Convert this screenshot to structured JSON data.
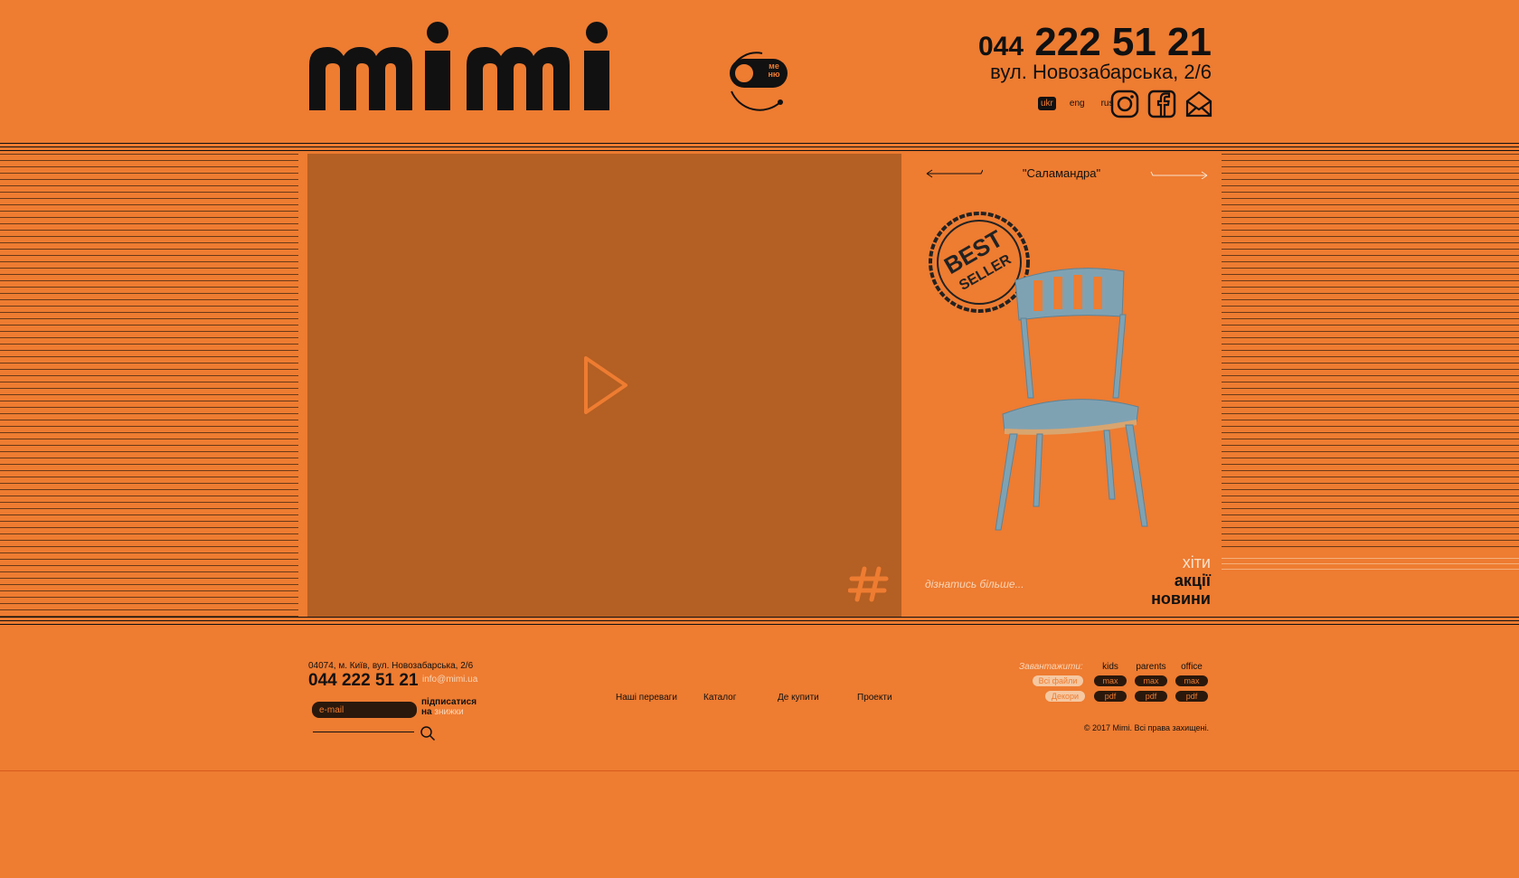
{
  "header": {
    "logo_text": "mimi",
    "menu_label_top": "ме",
    "menu_label_bottom": "ню",
    "phone_prefix": "044",
    "phone_number": "222 51 21",
    "address": "вул. Новозабарська, 2/6",
    "languages": [
      {
        "label": "ukr",
        "active": true
      },
      {
        "label": "eng",
        "active": false
      },
      {
        "label": "rus",
        "active": false
      }
    ],
    "social_icons": [
      "instagram-icon",
      "facebook-icon",
      "mail-icon"
    ]
  },
  "hero": {
    "product_name": "\"Саламандра\"",
    "stamp_text_top": "BEST",
    "stamp_text_bottom": "SELLER",
    "more_link": "дізнатись більше...",
    "categories": [
      "хіти",
      "акції",
      "новини"
    ]
  },
  "footer": {
    "address": "04074, м. Київ, вул. Новозабарська, 2/6",
    "phone": "044 222 51 21",
    "email": "info@mimi.ua",
    "email_placeholder": "e-mail",
    "subscribe_line1": "підписатися",
    "subscribe_line2_a": "на",
    "subscribe_line2_b": "знижки",
    "nav": [
      "Наші переваги",
      "Каталог",
      "Де купити",
      "Проекти"
    ],
    "download_label": "Завантажити:",
    "download_columns": [
      "kids",
      "parents",
      "office"
    ],
    "all_files": "Всі файли",
    "decors": "Декори",
    "max_label": "max",
    "pdf_label": "pdf",
    "copyright": "© 2017 Mimi. Всі права захищені."
  },
  "colors": {
    "background": "#ee7c31",
    "video_bg": "#b45f23",
    "text": "#111111",
    "chair": "#7fa2b3"
  }
}
